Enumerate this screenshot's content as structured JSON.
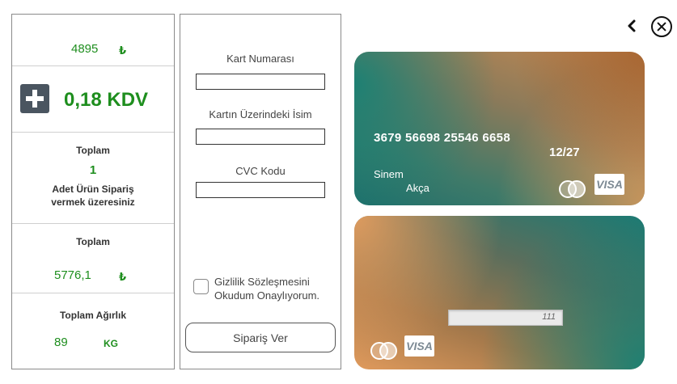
{
  "summary": {
    "price": "4895",
    "price_currency": "₺",
    "kdv": "0,18 KDV",
    "count_title": "Toplam",
    "count_value": "1",
    "count_text_line1": "Adet Ürün Sipariş",
    "count_text_line2": "vermek üzeresiniz",
    "total_title": "Toplam",
    "total_value": "5776,1",
    "total_currency": "₺",
    "weight_title": "Toplam Ağırlık",
    "weight_value": "89",
    "weight_unit": "KG"
  },
  "form": {
    "card_number_label": "Kart Numarası",
    "card_number_value": "",
    "card_name_label": "Kartın Üzerindeki İsim",
    "card_name_value": "",
    "cvc_label": "CVC Kodu",
    "cvc_value": "",
    "privacy_line1": "Gizlilik Sözleşmesini",
    "privacy_line2": "Okudum Onaylıyorum.",
    "privacy_checked": false,
    "order_button": "Sipariş Ver"
  },
  "card_front": {
    "number": "3679 56698 25546 6658",
    "expiry": "12/27",
    "first_name": "Sinem",
    "last_name": "Akça",
    "brand": "VISA"
  },
  "card_back": {
    "cvc": "111",
    "brand": "VISA"
  },
  "icons": {
    "plus": "plus-icon",
    "back": "chevron-left-icon",
    "close": "close-circle-icon",
    "mastercard": "mastercard-icon",
    "visa": "visa-logo"
  },
  "colors": {
    "accent_green": "#1e8e1e",
    "plus_button": "#4a5560"
  }
}
